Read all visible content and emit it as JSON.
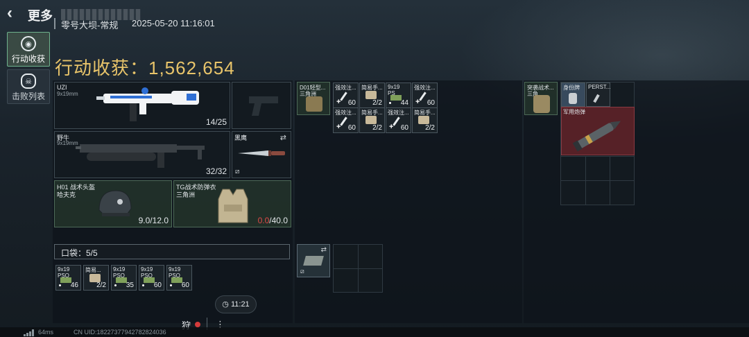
{
  "header": {
    "back_icon": "chevron-left-icon",
    "title": "更多",
    "map": "零号大坝-常规",
    "datetime": "2025-05-20 11:16:01",
    "harvest_label": "行动收获：1,562,654"
  },
  "tabs": [
    {
      "label": "行动收获",
      "icon": "target-icon",
      "active": true
    },
    {
      "label": "击败列表",
      "icon": "skull-icon",
      "active": false
    }
  ],
  "weapons": {
    "primary": {
      "name": "UZI",
      "caliber": "9x19mm",
      "ammo": "14/25"
    },
    "secondary": {
      "name": "野牛",
      "caliber": "9x19mm",
      "ammo": "32/32"
    },
    "melee": {
      "name": "黑鹰",
      "swap_icon": "swap-icon",
      "lock_icon": "no-insure-icon"
    }
  },
  "armor": {
    "helmet": {
      "name": "H01 战术头盔",
      "sub": "哈夫克",
      "durability": "9.0/12.0"
    },
    "vest": {
      "name": "TG战术防弹衣",
      "sub": "三角洲",
      "durability_current": "0.0",
      "durability_max": "/40.0"
    }
  },
  "pocket": {
    "label": "口袋：5/5",
    "items": [
      {
        "t": "9x19",
        "t2": "PSO",
        "n": "46"
      },
      {
        "t": "简易...",
        "t2": "",
        "n": "2/2"
      },
      {
        "t": "9x19",
        "t2": "PSO",
        "n": "35"
      },
      {
        "t": "9x19",
        "t2": "PSO",
        "n": "60"
      },
      {
        "t": "9x19",
        "t2": "PSO",
        "n": "60"
      }
    ]
  },
  "chest_rig": {
    "name": "D01轻型...",
    "sub": "三角洲",
    "items": [
      {
        "t": "强效注...",
        "n": "60",
        "plus": true
      },
      {
        "t": "简易手...",
        "n": "2/2",
        "plus": false
      },
      {
        "t": "9x19",
        "n": "44",
        "plus": false,
        "dot": true,
        "t2": "PS"
      },
      {
        "t": "强效注...",
        "n": "60",
        "plus": true
      },
      {
        "t": "强效注...",
        "n": "60",
        "plus": true
      },
      {
        "t": "简易手...",
        "n": "2/2",
        "plus": false
      },
      {
        "t": "强效注...",
        "n": "60",
        "plus": true
      },
      {
        "t": "简易手...",
        "n": "2/2",
        "plus": false
      }
    ]
  },
  "backpack": {
    "name": "突袭战术...",
    "sub": "三角",
    "items": [
      {
        "t": "身份牌"
      },
      {
        "t": "PERST..."
      },
      {
        "t": "军用炮弹"
      }
    ]
  },
  "bottom": {
    "timer": "11:21",
    "hunt_label": "狩",
    "kebab": "⋮",
    "ping": "64ms",
    "uid": "CN UID:18227377942782824036"
  },
  "colors": {
    "harvest": "#e8c46a",
    "accent_green": "#6fb38d",
    "danger": "#e04a48"
  }
}
